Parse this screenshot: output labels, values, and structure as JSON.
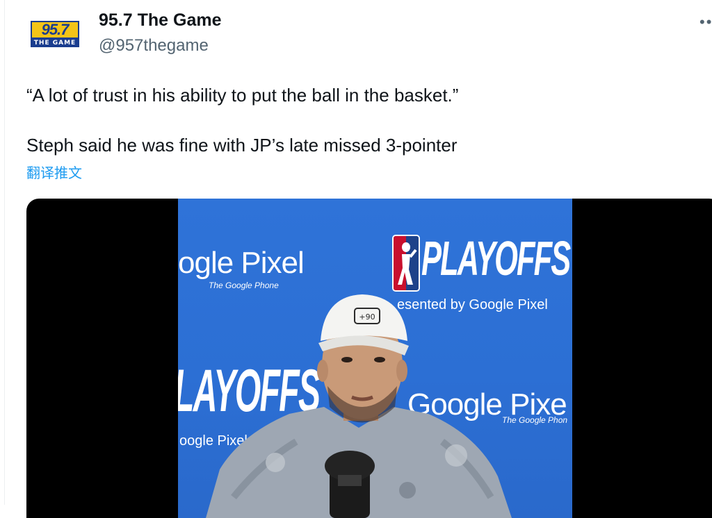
{
  "account": {
    "avatar_number": "95.7",
    "avatar_subtitle": "THE GAME",
    "display_name": "95.7 The Game",
    "handle": "@957thegame"
  },
  "tweet": {
    "line1": "“A lot of trust in his ability to put the ball in the basket.”",
    "line2": "Steph said he was fine with JP’s late missed 3-pointer",
    "translate_label": "翻译推文"
  },
  "media": {
    "backdrop": {
      "pixel_1": "ogle Pixel",
      "phone_1": "The Google Phone",
      "playoffs_1": "PLAYOFFS",
      "presented_1": "esented by Google Pixel",
      "playoffs_2": "LAYOFFS",
      "pixel_2": "oogle Pixel",
      "pixel_3": "Google Pixe",
      "phone_3": "The Google Phon"
    },
    "cap_logo": "+90"
  },
  "icons": {
    "more": "more-horizontal-icon",
    "nba": "nba-logo-icon"
  },
  "colors": {
    "brand_yellow": "#f3c417",
    "brand_blue": "#1a3d8f",
    "link": "#1d9bf0",
    "backdrop_blue": "#2f73d8"
  }
}
